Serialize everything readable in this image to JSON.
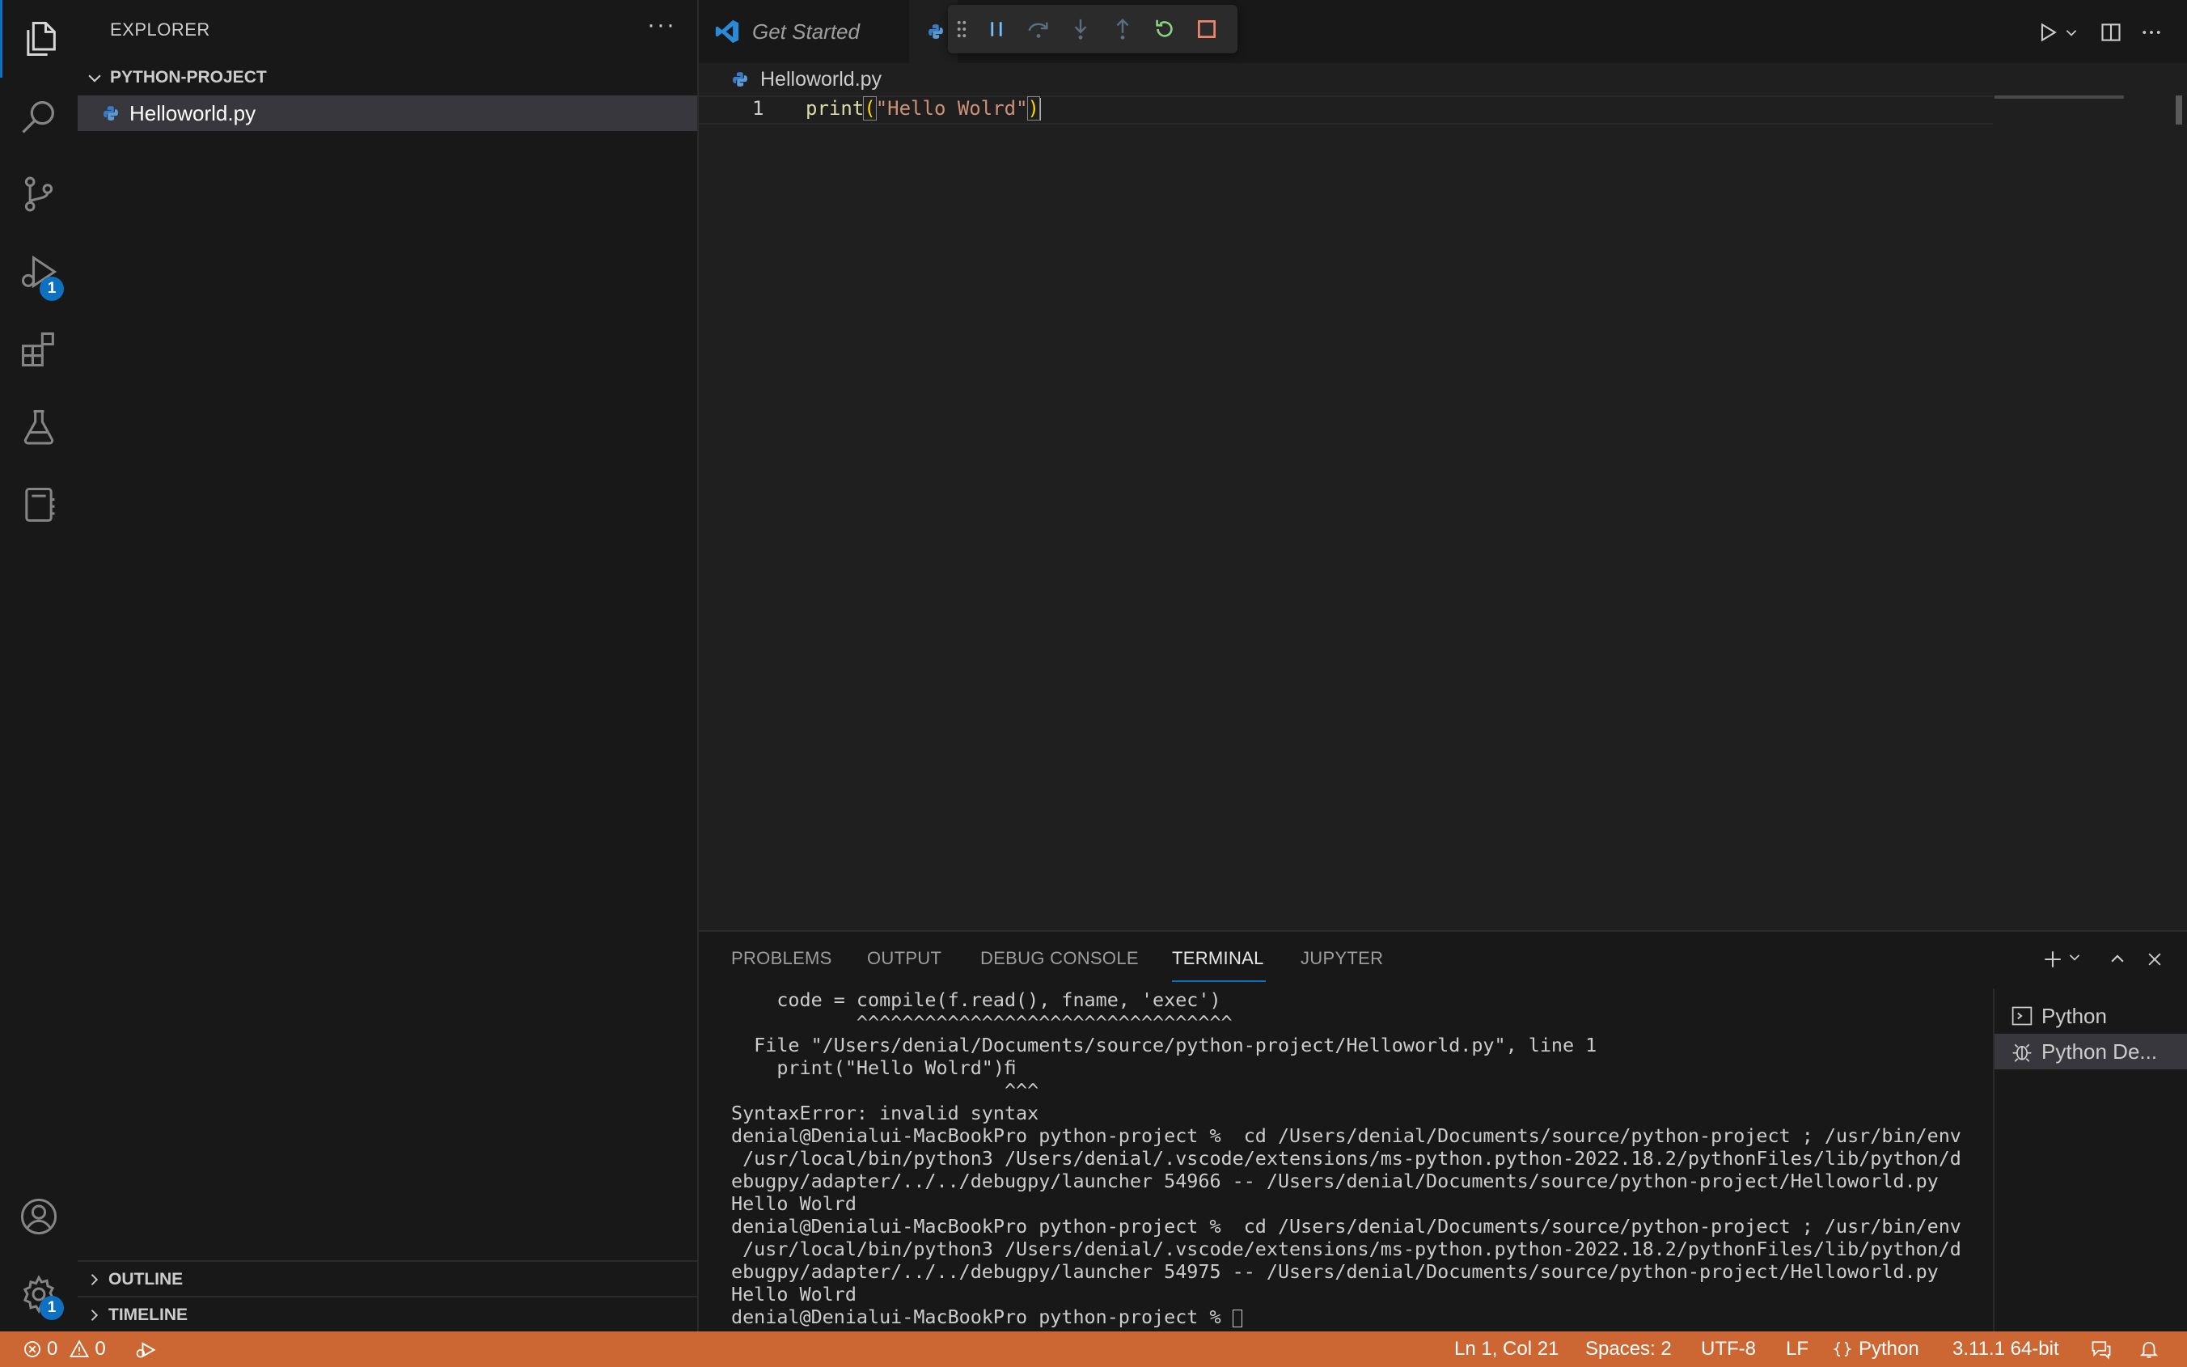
{
  "sidebar": {
    "title": "EXPLORER",
    "more": "···",
    "folder": "PYTHON-PROJECT",
    "file": "Helloworld.py",
    "outline": "OUTLINE",
    "timeline": "TIMELINE"
  },
  "activity": {
    "run_badge": "1",
    "settings_badge": "1"
  },
  "tabs": {
    "get_started": "Get Started"
  },
  "editor": {
    "breadcrumb_file": "Helloworld.py",
    "line_number": "1",
    "code_fn": "print",
    "code_open": "(",
    "code_str": "\"Hello Wolrd\"",
    "code_close": ")"
  },
  "panel": {
    "tabs": [
      "PROBLEMS",
      "OUTPUT",
      "DEBUG CONSOLE",
      "TERMINAL",
      "JUPYTER"
    ],
    "active_tab": "TERMINAL",
    "terminal_lines": [
      "    code = compile(f.read(), fname, 'exec')",
      "           ^^^^^^^^^^^^^^^^^^^^^^^^^^^^^^^^^",
      "",
      "  File \"/Users/denial/Documents/source/python-project/Helloworld.py\", line 1",
      "    print(\"Hello Wolrd\")ﬁ",
      "                        ^^^",
      "SyntaxError: invalid syntax",
      "denial@Denialui-MacBookPro python-project %  cd /Users/denial/Documents/source/python-project ; /usr/bin/env",
      " /usr/local/bin/python3 /Users/denial/.vscode/extensions/ms-python.python-2022.18.2/pythonFiles/lib/python/d",
      "ebugpy/adapter/../../debugpy/launcher 54966 -- /Users/denial/Documents/source/python-project/Helloworld.py",
      "Hello Wolrd",
      "denial@Denialui-MacBookPro python-project %  cd /Users/denial/Documents/source/python-project ; /usr/bin/env",
      " /usr/local/bin/python3 /Users/denial/.vscode/extensions/ms-python.python-2022.18.2/pythonFiles/lib/python/d",
      "ebugpy/adapter/../../debugpy/launcher 54975 -- /Users/denial/Documents/source/python-project/Helloworld.py",
      "Hello Wolrd",
      "denial@Denialui-MacBookPro python-project % "
    ],
    "terminals": [
      "Python",
      "Python De..."
    ]
  },
  "status": {
    "errors": "0",
    "warnings": "0",
    "position": "Ln 1, Col 21",
    "spaces": "Spaces: 2",
    "encoding": "UTF-8",
    "eol": "LF",
    "language": "Python",
    "interpreter": "3.11.1 64-bit"
  },
  "colors": {
    "status_bar": "#cc6633",
    "accent": "#0e70c0",
    "active_tab_underline": "#0e70c0"
  }
}
